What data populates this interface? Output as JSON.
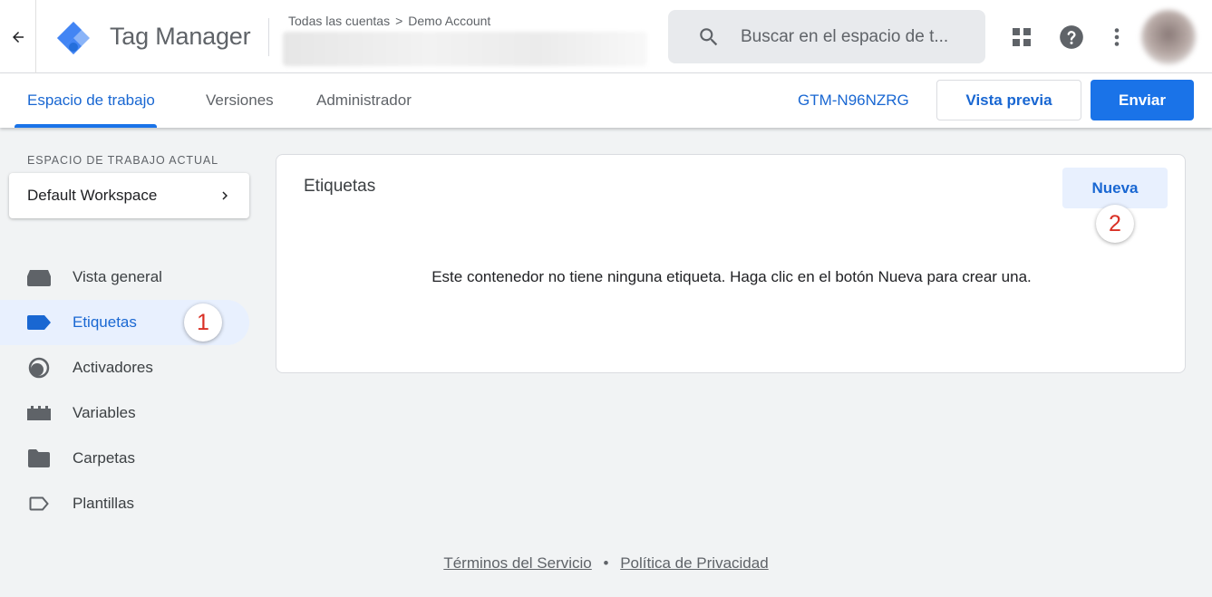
{
  "header": {
    "product_name": "Tag Manager",
    "breadcrumb": {
      "all_accounts": "Todas las cuentas",
      "separator": ">",
      "account": "Demo Account"
    },
    "search_placeholder": "Buscar en el espacio de t..."
  },
  "subnav": {
    "tabs": [
      {
        "label": "Espacio de trabajo",
        "active": true
      },
      {
        "label": "Versiones",
        "active": false
      },
      {
        "label": "Administrador",
        "active": false
      }
    ],
    "container_id": "GTM-N96NZRG",
    "preview_label": "Vista previa",
    "submit_label": "Enviar"
  },
  "sidebar": {
    "workspace_heading": "ESPACIO DE TRABAJO ACTUAL",
    "workspace_name": "Default Workspace",
    "items": [
      {
        "label": "Vista general",
        "icon": "overview-icon",
        "active": false
      },
      {
        "label": "Etiquetas",
        "icon": "tag-icon",
        "active": true
      },
      {
        "label": "Activadores",
        "icon": "trigger-icon",
        "active": false
      },
      {
        "label": "Variables",
        "icon": "variables-icon",
        "active": false
      },
      {
        "label": "Carpetas",
        "icon": "folder-icon",
        "active": false
      },
      {
        "label": "Plantillas",
        "icon": "template-icon",
        "active": false
      }
    ]
  },
  "main": {
    "card_title": "Etiquetas",
    "new_button": "Nueva",
    "empty_message": "Este contenedor no tiene ninguna etiqueta. Haga clic en el botón Nueva para crear una."
  },
  "annotations": {
    "step1": "1",
    "step2": "2"
  },
  "footer": {
    "terms": "Términos del Servicio",
    "separator": "•",
    "privacy": "Política de Privacidad"
  },
  "colors": {
    "accent": "#1a73e8",
    "accent_text": "#1967d2",
    "active_bg": "#e8f0fe",
    "badge_text": "#d93025"
  }
}
